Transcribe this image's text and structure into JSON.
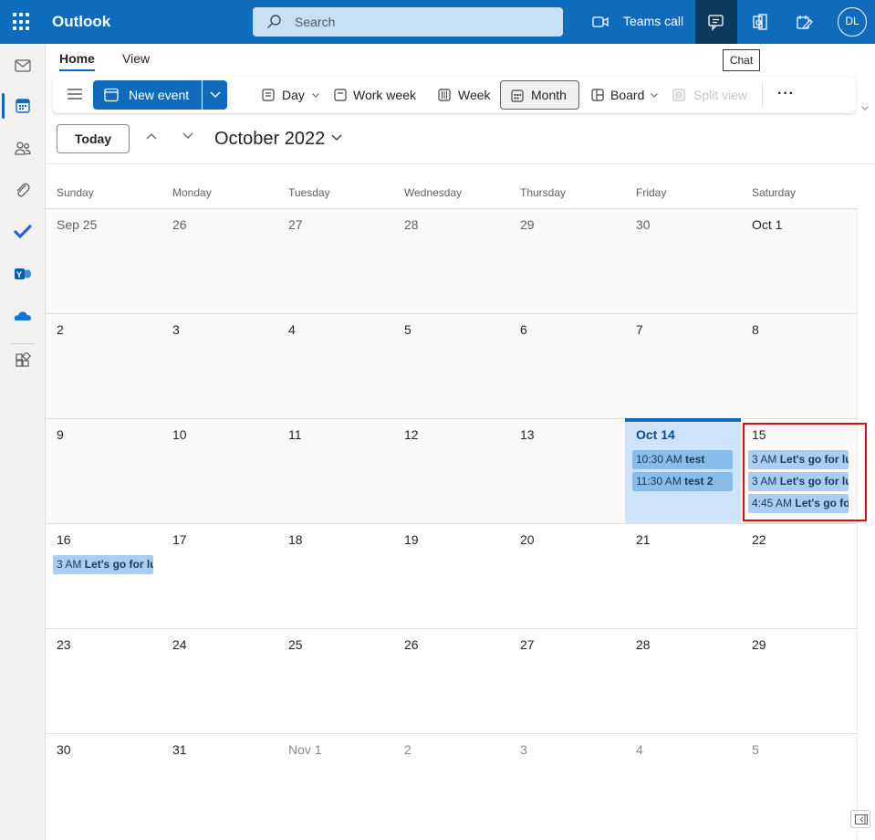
{
  "header": {
    "app_name": "Outlook",
    "search_placeholder": "Search",
    "teams_call_label": "Teams call",
    "avatar_initials": "DL",
    "chat_tooltip": "Chat"
  },
  "ribbon": {
    "tabs": [
      {
        "label": "Home",
        "active": true
      },
      {
        "label": "View",
        "active": false
      }
    ],
    "new_event_label": "New event",
    "views": {
      "day": "Day",
      "work_week": "Work week",
      "week": "Week",
      "month": "Month",
      "board": "Board",
      "split_view": "Split view"
    },
    "more_label": "···",
    "selected_view": "Month"
  },
  "nav": {
    "today_label": "Today",
    "month_title": "October 2022"
  },
  "calendar": {
    "weekdays": [
      "Sunday",
      "Monday",
      "Tuesday",
      "Wednesday",
      "Thursday",
      "Friday",
      "Saturday"
    ],
    "weeks": [
      [
        "Sep 25",
        "26",
        "27",
        "28",
        "29",
        "30",
        "Oct 1"
      ],
      [
        "2",
        "3",
        "4",
        "5",
        "6",
        "7",
        "8"
      ],
      [
        "9",
        "10",
        "11",
        "12",
        "13",
        "Oct 14",
        "15"
      ],
      [
        "16",
        "17",
        "18",
        "19",
        "20",
        "21",
        "22"
      ],
      [
        "23",
        "24",
        "25",
        "26",
        "27",
        "28",
        "29"
      ],
      [
        "30",
        "31",
        "Nov 1",
        "2",
        "3",
        "4",
        "5"
      ]
    ],
    "today": "Oct 14",
    "events": {
      "oct14": [
        {
          "time": "10:30 AM",
          "title": "test"
        },
        {
          "time": "11:30 AM",
          "title": "test 2"
        }
      ],
      "oct15": [
        {
          "time": "3 AM",
          "title": "Let's go for lu"
        },
        {
          "time": "3 AM",
          "title": "Let's go for lu"
        },
        {
          "time": "4:45 AM",
          "title": "Let's go fo"
        }
      ],
      "oct16": [
        {
          "time": "3 AM",
          "title": "Let's go for lu"
        }
      ]
    }
  },
  "colors": {
    "brand": "#0f6cbd",
    "today_bg": "#cfe4fa",
    "event_bg": "#a9cef0",
    "highlight": "#e00b0b"
  }
}
